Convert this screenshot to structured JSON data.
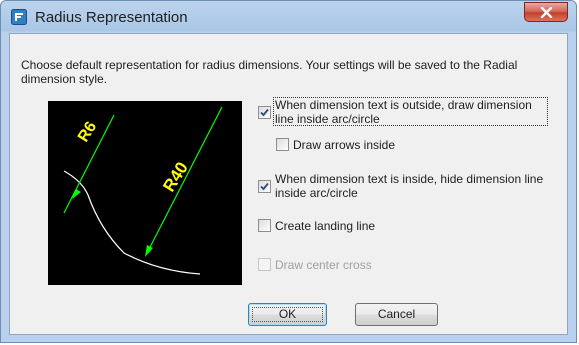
{
  "window": {
    "title": "Radius Representation",
    "close_icon": "close-icon"
  },
  "description": "Choose default representation for radius dimensions. Your settings will be saved to the Radial dimension style.",
  "preview": {
    "label_small": "R6",
    "label_large": "R40",
    "colors": {
      "background": "#000000",
      "text": "#ffff00",
      "dimension": "#00ff00",
      "arc": "#ffffff"
    }
  },
  "options": [
    {
      "label": "When dimension text is outside, draw dimension line inside arc/circle",
      "checked": true,
      "enabled": true
    },
    {
      "label": "Draw arrows inside",
      "checked": false,
      "enabled": true
    },
    {
      "label": "When dimension text is inside, hide dimension line inside arc/circle",
      "checked": true,
      "enabled": true
    },
    {
      "label": "Create landing line",
      "checked": false,
      "enabled": true
    },
    {
      "label": "Draw center cross",
      "checked": false,
      "enabled": false
    }
  ],
  "buttons": {
    "ok": "OK",
    "cancel": "Cancel"
  }
}
